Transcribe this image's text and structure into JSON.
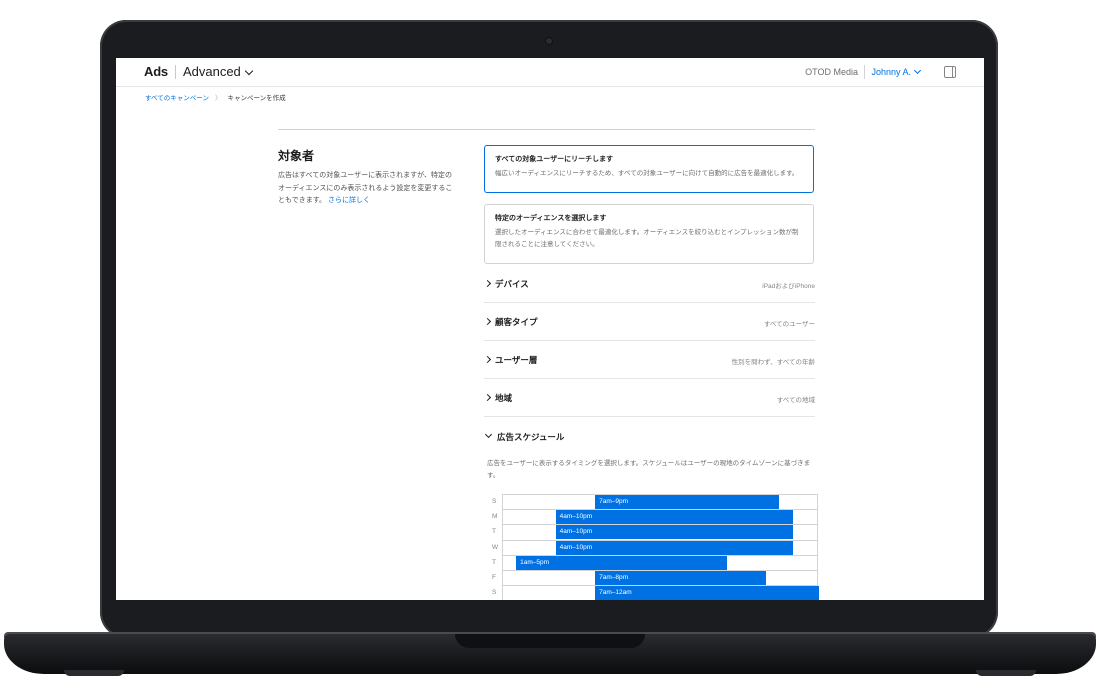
{
  "header": {
    "brand": "Ads",
    "mode": "Advanced",
    "org": "OTOD Media",
    "user": "Johnny A."
  },
  "breadcrumb": {
    "link": "すべてのキャンペーン",
    "current": "キャンペーンを作成"
  },
  "section": {
    "title": "対象者",
    "desc": "広告はすべての対象ユーザーに表示されますが、特定のオーディエンスにのみ表示されるよう設定を変更することもできます。",
    "learn_more": "さらに詳しく"
  },
  "options": [
    {
      "title": "すべての対象ユーザーにリーチします",
      "desc": "幅広いオーディエンスにリーチするため、すべての対象ユーザーに向けて自動的に広告を最適化します。",
      "selected": true
    },
    {
      "title": "特定のオーディエンスを選択します",
      "desc": "選択したオーディエンスに合わせて最適化します。オーディエンスを絞り込むとインプレッション数が制限されることに注意してください。",
      "selected": false
    }
  ],
  "rows": [
    {
      "label": "デバイス",
      "value": "iPadおよびiPhone"
    },
    {
      "label": "顧客タイプ",
      "value": "すべてのユーザー"
    },
    {
      "label": "ユーザー層",
      "value": "性別を問わず、すべての年齢"
    },
    {
      "label": "地域",
      "value": "すべての地域"
    }
  ],
  "schedule": {
    "label": "広告スケジュール",
    "desc": "広告をユーザーに表示するタイミングを選択します。スケジュールはユーザーの現地のタイムゾーンに基づきます。",
    "days": [
      {
        "day": "S",
        "range": "7am–9pm",
        "start": 7,
        "end": 21
      },
      {
        "day": "M",
        "range": "4am–10pm",
        "start": 4,
        "end": 22
      },
      {
        "day": "T",
        "range": "4am–10pm",
        "start": 4,
        "end": 22
      },
      {
        "day": "W",
        "range": "4am–10pm",
        "start": 4,
        "end": 22
      },
      {
        "day": "T",
        "range": "1am–5pm",
        "start": 1,
        "end": 17
      },
      {
        "day": "F",
        "range": "7am–8pm",
        "start": 7,
        "end": 20
      },
      {
        "day": "S",
        "range": "7am–12am",
        "start": 7,
        "end": 24
      }
    ]
  },
  "colors": {
    "accent": "#0071e3"
  }
}
